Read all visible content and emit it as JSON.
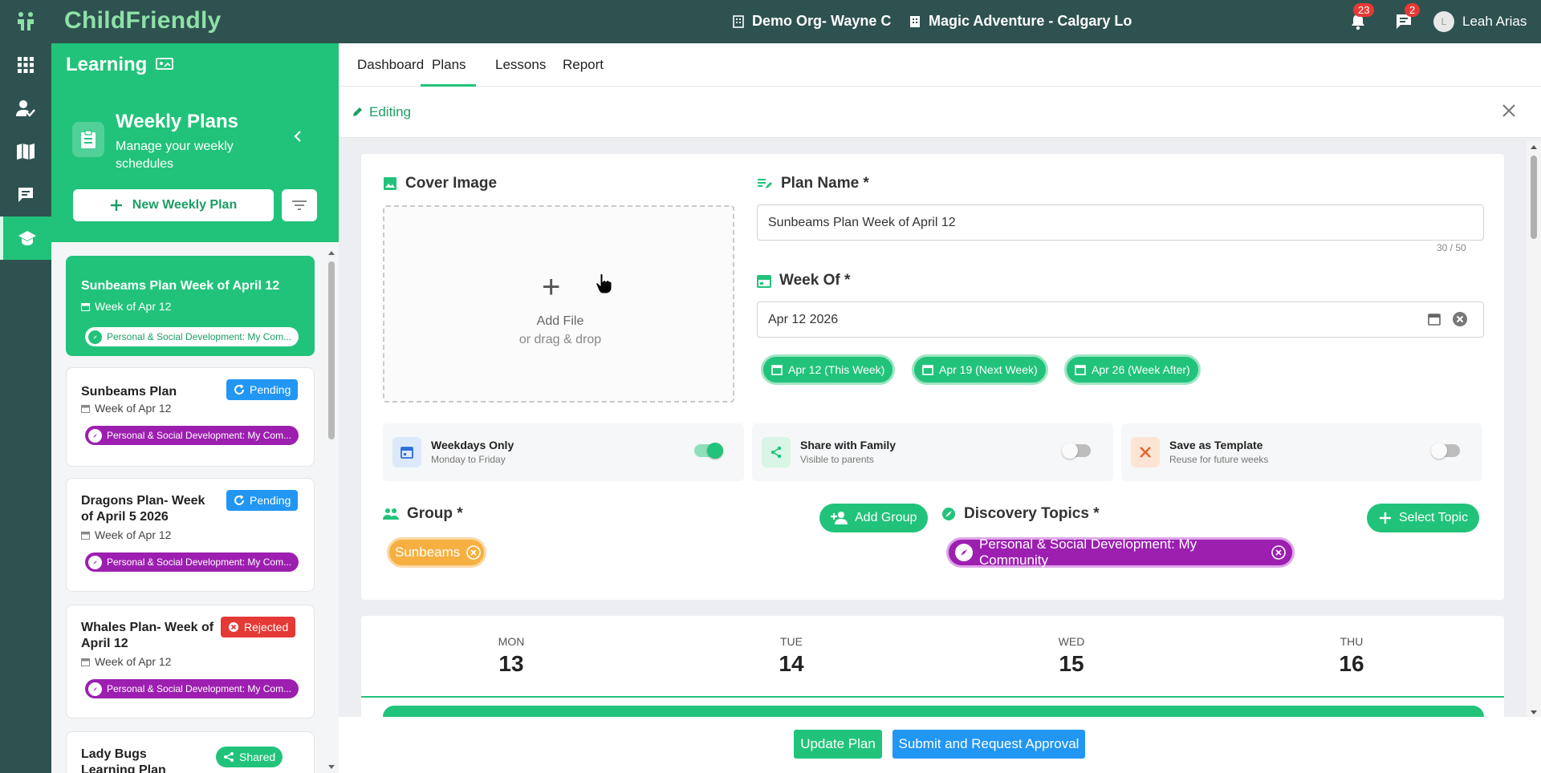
{
  "brand": {
    "name": "ChildFriendly"
  },
  "topbar": {
    "org": "Demo Org- Wayne C",
    "location": "Magic Adventure - Calgary Lo",
    "notifications_count": "23",
    "messages_count": "2",
    "user_initial": "L",
    "user_name": "Leah Arias"
  },
  "module": {
    "title": "Learning"
  },
  "tabs": [
    {
      "label": "Dashboard",
      "active": false
    },
    {
      "label": "Plans",
      "active": true
    },
    {
      "label": "Lessons",
      "active": false
    },
    {
      "label": "Report",
      "active": false
    }
  ],
  "sidebar": {
    "title": "Weekly Plans",
    "subtitle": "Manage your weekly schedules",
    "new_button": "New Weekly Plan",
    "plans": [
      {
        "title": "Sunbeams Plan Week of April 12",
        "week": "Week of Apr 12",
        "status": "",
        "topic": "Personal & Social Development: My Com...",
        "selected": true
      },
      {
        "title": "Sunbeams Plan",
        "week": "Week of Apr 12",
        "status": "Pending",
        "topic": "Personal & Social Development: My Com...",
        "selected": false
      },
      {
        "title": "Dragons Plan- Week of April 5 2026",
        "week": "Week of Apr 12",
        "status": "Pending",
        "topic": "Personal & Social Development: My Com...",
        "selected": false
      },
      {
        "title": "Whales Plan- Week of April 12",
        "week": "Week of Apr 12",
        "status": "Rejected",
        "topic": "Personal & Social Development: My Com...",
        "selected": false
      },
      {
        "title": "Lady Bugs Learning Plan",
        "week": "",
        "status": "Shared",
        "topic": "",
        "selected": false
      }
    ]
  },
  "editor": {
    "mode_label": "Editing",
    "cover": {
      "label": "Cover Image",
      "add_file": "Add File",
      "drag_hint": "or drag & drop"
    },
    "plan_name": {
      "label": "Plan Name *",
      "value": "Sunbeams Plan Week of April 12",
      "counter": "30 / 50"
    },
    "week_of": {
      "label": "Week Of *",
      "value": "Apr 12 2026"
    },
    "quick_weeks": [
      "Apr 12 (This Week)",
      "Apr 19 (Next Week)",
      "Apr 26 (Week After)"
    ],
    "options": [
      {
        "title": "Weekdays Only",
        "subtitle": "Monday to Friday",
        "on": true
      },
      {
        "title": "Share with Family",
        "subtitle": "Visible to parents",
        "on": false
      },
      {
        "title": "Save as Template",
        "subtitle": "Reuse for future weeks",
        "on": false
      }
    ],
    "group": {
      "label": "Group *",
      "add_button": "Add Group",
      "selected": "Sunbeams"
    },
    "topics": {
      "label": "Discovery Topics *",
      "select_button": "Select Topic",
      "selected": "Personal & Social Development: My Community"
    },
    "calendar": [
      {
        "day": "MON",
        "date": "13"
      },
      {
        "day": "TUE",
        "date": "14"
      },
      {
        "day": "WED",
        "date": "15"
      },
      {
        "day": "THU",
        "date": "16"
      }
    ],
    "actions": {
      "update": "Update Plan",
      "submit": "Submit and Request Approval"
    }
  },
  "colors": {
    "primary": "#21c37a",
    "dark": "#2e5250",
    "pending": "#2196f3",
    "rejected": "#e53935",
    "topic": "#9c1fb0",
    "group": "#f5b041"
  }
}
